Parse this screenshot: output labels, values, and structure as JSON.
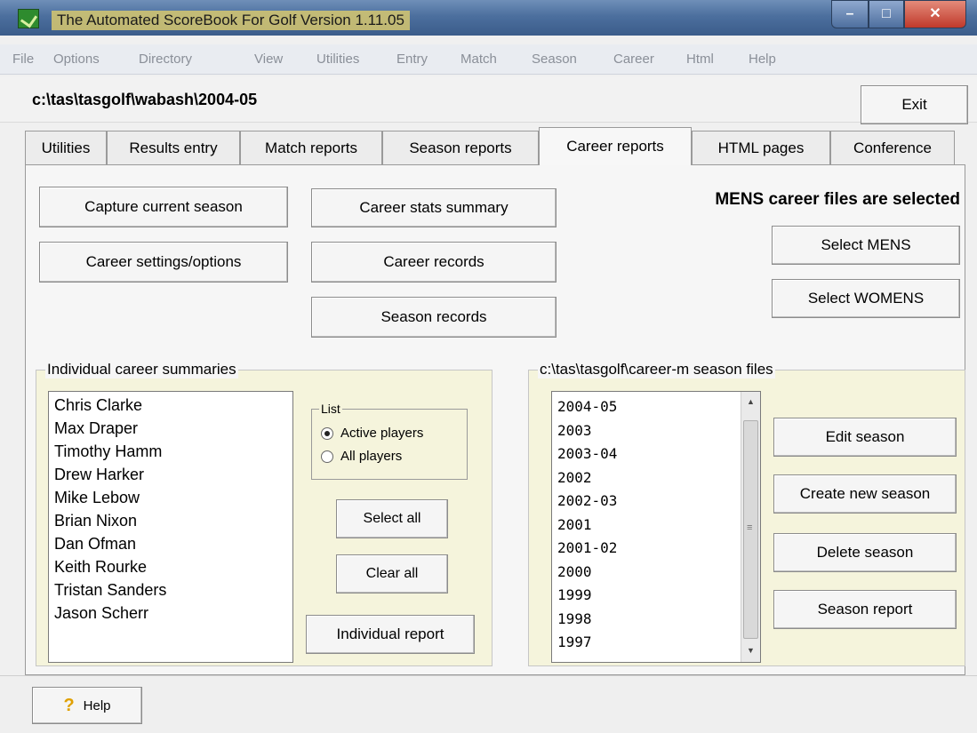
{
  "window": {
    "title": "The Automated ScoreBook For Golf  Version 1.11.05"
  },
  "menu": [
    "File",
    "Options",
    "Directory",
    "View",
    "Utilities",
    "Entry",
    "Match",
    "Season",
    "Career",
    "Html",
    "Help"
  ],
  "path": "c:\\tas\\tasgolf\\wabash\\2004-05",
  "exit_label": "Exit",
  "tabs": [
    "Utilities",
    "Results entry",
    "Match reports",
    "Season reports",
    "Career reports",
    "HTML pages",
    "Conference"
  ],
  "active_tab": "Career reports",
  "buttons": {
    "capture": "Capture current season",
    "settings": "Career settings/options",
    "stats_summary": "Career stats summary",
    "career_records": "Career records",
    "season_records": "Season records",
    "select_mens": "Select MENS",
    "select_womens": "Select WOMENS",
    "select_all": "Select all",
    "clear_all": "Clear all",
    "individual_report": "Individual report",
    "edit_season": "Edit season",
    "create_season": "Create new season",
    "delete_season": "Delete season",
    "season_report": "Season report",
    "help": "Help"
  },
  "status_message": "MENS career files are selected",
  "individual": {
    "group_label": "Individual career summaries",
    "players": [
      "Chris Clarke",
      "Max Draper",
      "Timothy Hamm",
      "Drew Harker",
      "Mike Lebow",
      "Brian Nixon",
      "Dan Ofman",
      "Keith Rourke",
      "Tristan Sanders",
      "Jason Scherr"
    ],
    "list_label": "List",
    "radio_active": "Active players",
    "radio_all": "All players",
    "selected_option": "Active players"
  },
  "seasons": {
    "group_label": "c:\\tas\\tasgolf\\career-m season files",
    "items": [
      "2004-05",
      "2003",
      "2003-04",
      "2002",
      "2002-03",
      "2001",
      "2001-02",
      "2000",
      "1999",
      "1998",
      "1997"
    ]
  }
}
